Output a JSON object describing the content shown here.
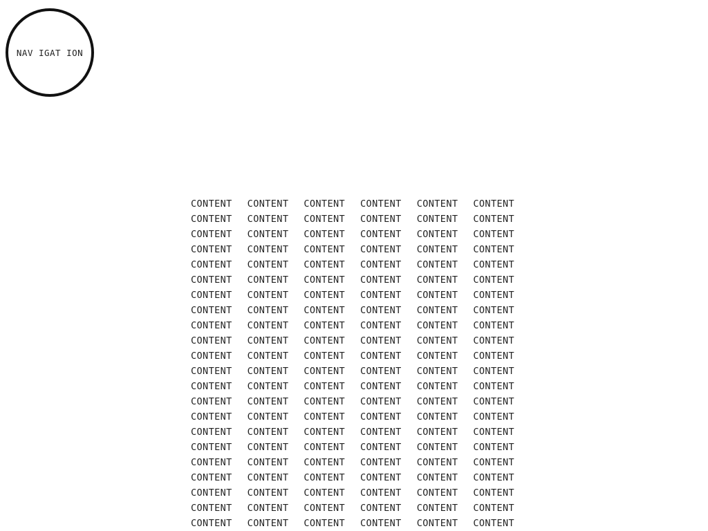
{
  "navigation": {
    "label": "NAV IGAT ION"
  },
  "content": {
    "rows": [
      [
        "CONTENT",
        "CONTENT",
        "CONTENT",
        "CONTENT",
        "CONTENT",
        "CONTENT"
      ],
      [
        "CONTENT",
        "CONTENT",
        "CONTENT",
        "CONTENT",
        "CONTENT",
        "CONTENT"
      ],
      [
        "CONTENT",
        "CONTENT",
        "CONTENT",
        "CONTENT",
        "CONTENT",
        "CONTENT"
      ],
      [
        "CONTENT",
        "CONTENT",
        "CONTENT",
        "CONTENT",
        "CONTENT",
        "CONTENT"
      ],
      [
        "CONTENT",
        "CONTENT",
        "CONTENT",
        "CONTENT",
        "CONTENT",
        "CONTENT"
      ],
      [
        "CONTENT",
        "CONTENT",
        "CONTENT",
        "CONTENT",
        "CONTENT",
        "CONTENT"
      ],
      [
        "CONTENT",
        "CONTENT",
        "CONTENT",
        "CONTENT",
        "CONTENT",
        "CONTENT"
      ],
      [
        "CONTENT",
        "CONTENT",
        "CONTENT",
        "CONTENT",
        "CONTENT",
        "CONTENT"
      ],
      [
        "CONTENT",
        "CONTENT",
        "CONTENT",
        "CONTENT",
        "CONTENT",
        "CONTENT"
      ],
      [
        "CONTENT",
        "CONTENT",
        "CONTENT",
        "CONTENT",
        "CONTENT",
        "CONTENT"
      ],
      [
        "CONTENT",
        "CONTENT",
        "CONTENT",
        "CONTENT",
        "CONTENT",
        "CONTENT"
      ],
      [
        "CONTENT",
        "CONTENT",
        "CONTENT",
        "CONTENT",
        "CONTENT",
        "CONTENT"
      ],
      [
        "CONTENT",
        "CONTENT",
        "CONTENT",
        "CONTENT",
        "CONTENT",
        "CONTENT"
      ],
      [
        "CONTENT",
        "CONTENT",
        "CONTENT",
        "CONTENT",
        "CONTENT",
        "CONTENT"
      ],
      [
        "CONTENT",
        "CONTENT",
        "CONTENT",
        "CONTENT",
        "CONTENT",
        "CONTENT"
      ],
      [
        "CONTENT",
        "CONTENT",
        "CONTENT",
        "CONTENT",
        "CONTENT",
        "CONTENT"
      ],
      [
        "CONTENT",
        "CONTENT",
        "CONTENT",
        "CONTENT",
        "CONTENT",
        "CONTENT"
      ],
      [
        "CONTENT",
        "CONTENT",
        "CONTENT",
        "CONTENT",
        "CONTENT",
        "CONTENT"
      ],
      [
        "CONTENT",
        "CONTENT",
        "CONTENT",
        "CONTENT",
        "CONTENT",
        "CONTENT"
      ],
      [
        "CONTENT",
        "CONTENT",
        "CONTENT",
        "CONTENT",
        "CONTENT",
        "CONTENT"
      ],
      [
        "CONTENT",
        "CONTENT",
        "CONTENT",
        "CONTENT",
        "CONTENT",
        "CONTENT"
      ],
      [
        "CONTENT",
        "CONTENT",
        "CONTENT",
        "CONTENT",
        "CONTENT",
        "CONTENT"
      ]
    ]
  }
}
